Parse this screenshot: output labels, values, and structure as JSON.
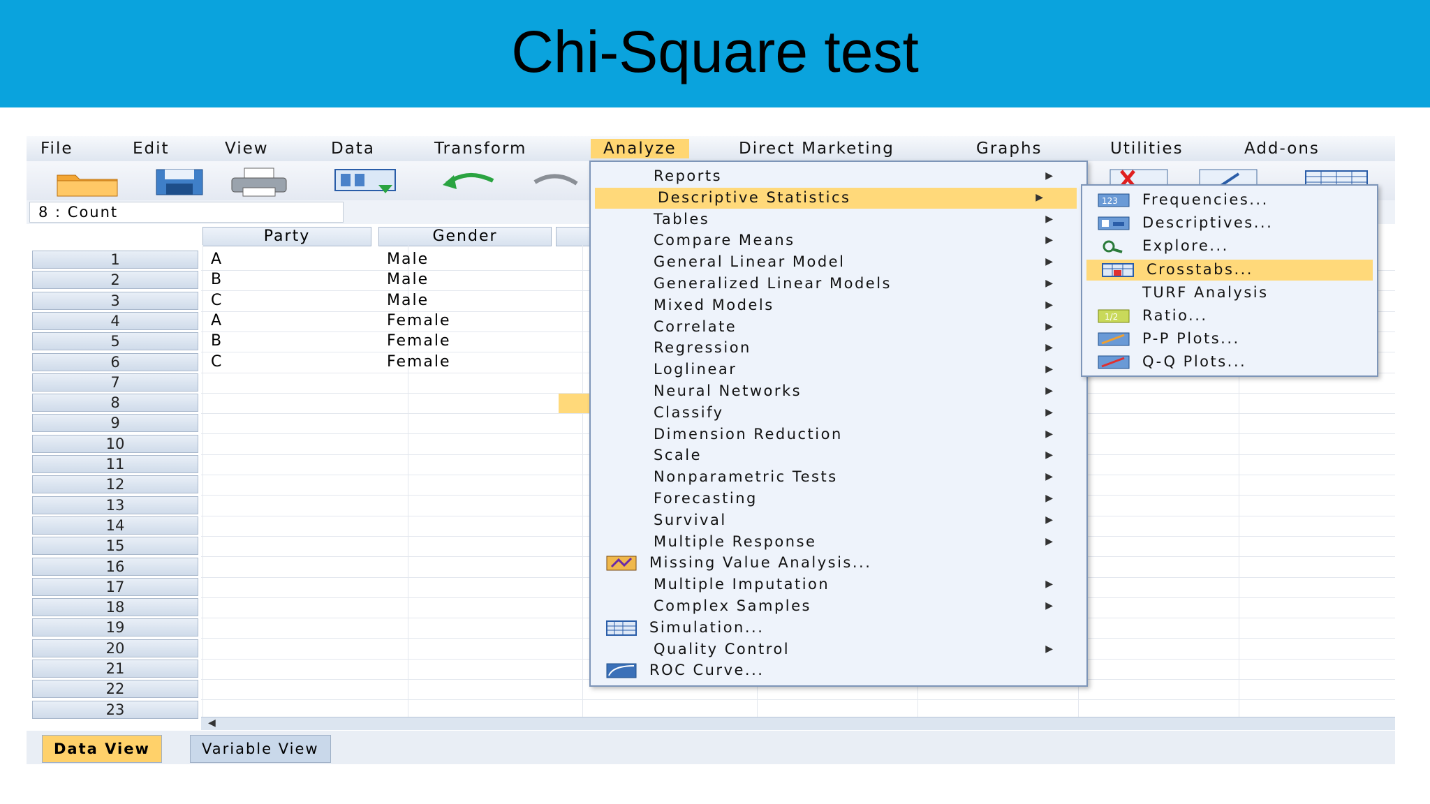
{
  "slide": {
    "title": "Chi-Square test"
  },
  "menubar": {
    "items": [
      "File",
      "Edit",
      "View",
      "Data",
      "Transform",
      "Analyze",
      "Direct Marketing",
      "Graphs",
      "Utilities",
      "Add-ons"
    ],
    "active": "Analyze"
  },
  "cell_reference": "8 : Count",
  "grid": {
    "columns": [
      "Party",
      "Gender"
    ],
    "rows": [
      {
        "n": "1",
        "party": "A",
        "gender": "Male"
      },
      {
        "n": "2",
        "party": "B",
        "gender": "Male"
      },
      {
        "n": "3",
        "party": "C",
        "gender": "Male"
      },
      {
        "n": "4",
        "party": "A",
        "gender": "Female"
      },
      {
        "n": "5",
        "party": "B",
        "gender": "Female"
      },
      {
        "n": "6",
        "party": "C",
        "gender": "Female"
      },
      {
        "n": "7"
      },
      {
        "n": "8"
      },
      {
        "n": "9"
      },
      {
        "n": "10"
      },
      {
        "n": "11"
      },
      {
        "n": "12"
      },
      {
        "n": "13"
      },
      {
        "n": "14"
      },
      {
        "n": "15"
      },
      {
        "n": "16"
      },
      {
        "n": "17"
      },
      {
        "n": "18"
      },
      {
        "n": "19"
      },
      {
        "n": "20"
      },
      {
        "n": "21"
      },
      {
        "n": "22"
      },
      {
        "n": "23"
      }
    ]
  },
  "analyze_menu": [
    {
      "label": "Reports",
      "submenu": true
    },
    {
      "label": "Descriptive Statistics",
      "submenu": true,
      "highlighted": true
    },
    {
      "label": "Tables",
      "submenu": true
    },
    {
      "label": "Compare Means",
      "submenu": true
    },
    {
      "label": "General Linear Model",
      "submenu": true
    },
    {
      "label": "Generalized Linear Models",
      "submenu": true
    },
    {
      "label": "Mixed Models",
      "submenu": true
    },
    {
      "label": "Correlate",
      "submenu": true
    },
    {
      "label": "Regression",
      "submenu": true
    },
    {
      "label": "Loglinear",
      "submenu": true
    },
    {
      "label": "Neural Networks",
      "submenu": true
    },
    {
      "label": "Classify",
      "submenu": true
    },
    {
      "label": "Dimension Reduction",
      "submenu": true
    },
    {
      "label": "Scale",
      "submenu": true
    },
    {
      "label": "Nonparametric Tests",
      "submenu": true
    },
    {
      "label": "Forecasting",
      "submenu": true
    },
    {
      "label": "Survival",
      "submenu": true
    },
    {
      "label": "Multiple Response",
      "submenu": true
    },
    {
      "label": "Missing Value Analysis...",
      "submenu": false,
      "icon": "missing-value-icon"
    },
    {
      "label": "Multiple Imputation",
      "submenu": true
    },
    {
      "label": "Complex Samples",
      "submenu": true
    },
    {
      "label": "Simulation...",
      "submenu": false,
      "icon": "simulation-icon"
    },
    {
      "label": "Quality Control",
      "submenu": true
    },
    {
      "label": "ROC Curve...",
      "submenu": false,
      "icon": "roc-curve-icon"
    }
  ],
  "descriptive_submenu": [
    {
      "label": "Frequencies...",
      "icon": "frequencies-icon"
    },
    {
      "label": "Descriptives...",
      "icon": "descriptives-icon"
    },
    {
      "label": "Explore...",
      "icon": "explore-icon"
    },
    {
      "label": "Crosstabs...",
      "icon": "crosstabs-icon",
      "highlighted": true
    },
    {
      "label": "TURF Analysis",
      "icon": ""
    },
    {
      "label": "Ratio...",
      "icon": "ratio-icon"
    },
    {
      "label": "P-P Plots...",
      "icon": "pp-plots-icon"
    },
    {
      "label": "Q-Q Plots...",
      "icon": "qq-plots-icon"
    }
  ],
  "view_tabs": {
    "data_view": "Data View",
    "variable_view": "Variable View"
  },
  "colors": {
    "banner": "#0aa3dd",
    "highlight": "#ffd97a",
    "menu_bg": "#eef3fb"
  }
}
